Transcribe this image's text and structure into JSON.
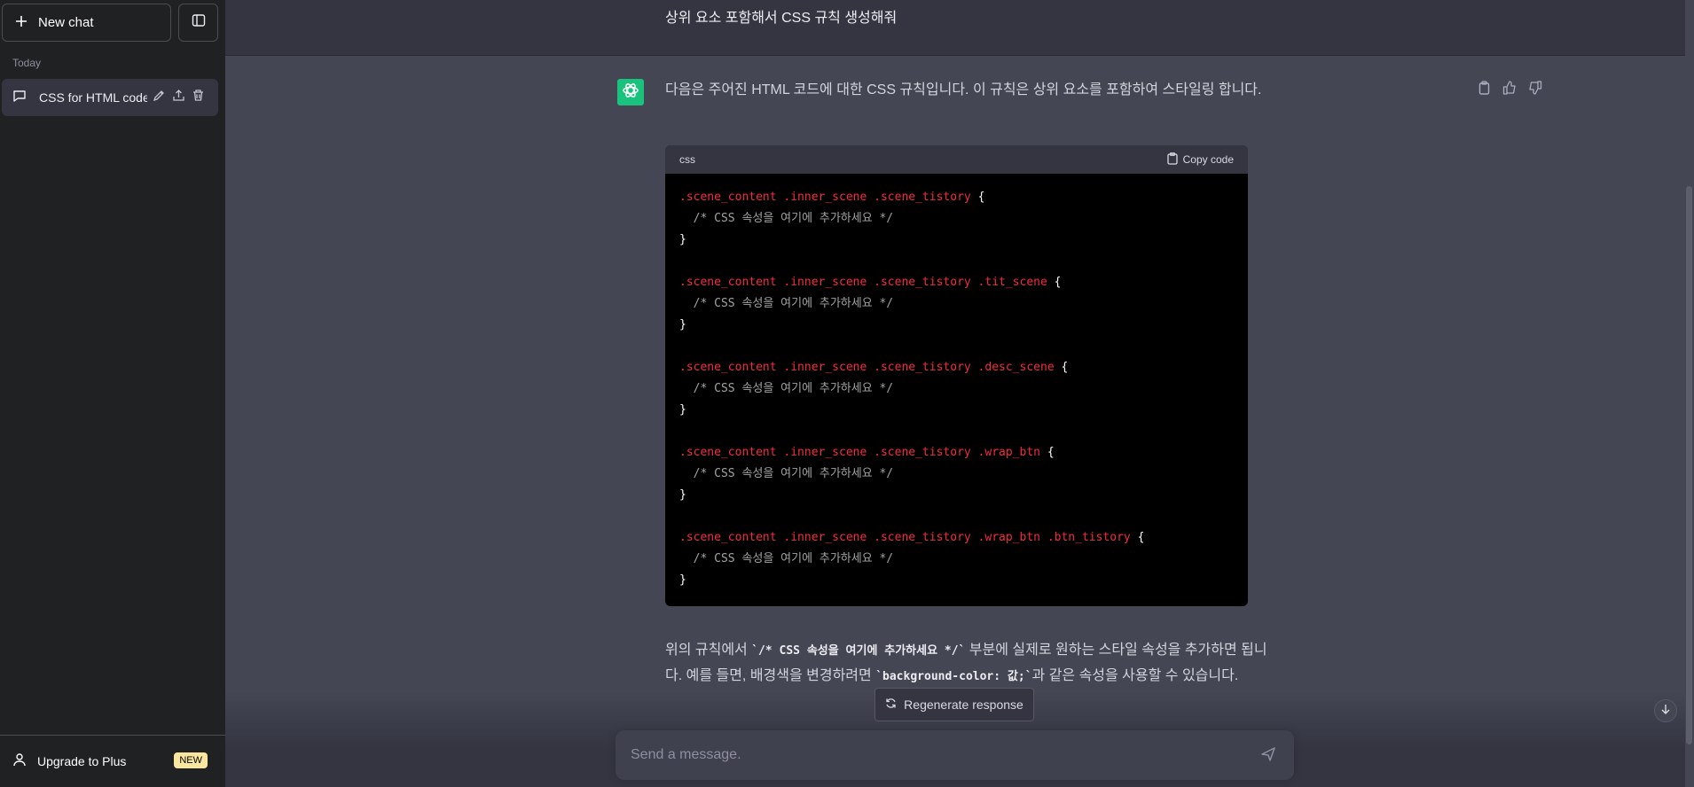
{
  "sidebar": {
    "new_chat_label": "New chat",
    "section_label": "Today",
    "chat_items": [
      {
        "label": "CSS for HTML code"
      }
    ],
    "upgrade_label": "Upgrade to Plus",
    "upgrade_badge": "NEW"
  },
  "conversation": {
    "user_message": "상위 요소 포함해서 CSS 규칙 생성해줘",
    "assistant_intro": "다음은 주어진 HTML 코드에 대한 CSS 규칙입니다. 이 규칙은 상위 요소를 포함하여 스타일링 합니다.",
    "code_language": "css",
    "copy_label": "Copy code",
    "code_blocks": [
      {
        "selector": ".scene_content .inner_scene .scene_tistory",
        "comment": "/* CSS 속성을 여기에 추가하세요 */"
      },
      {
        "selector": ".scene_content .inner_scene .scene_tistory .tit_scene",
        "comment": "/* CSS 속성을 여기에 추가하세요 */"
      },
      {
        "selector": ".scene_content .inner_scene .scene_tistory .desc_scene",
        "comment": "/* CSS 속성을 여기에 추가하세요 */"
      },
      {
        "selector": ".scene_content .inner_scene .scene_tistory .wrap_btn",
        "comment": "/* CSS 속성을 여기에 추가하세요 */"
      },
      {
        "selector": ".scene_content .inner_scene .scene_tistory .wrap_btn .btn_tistory",
        "comment": "/* CSS 속성을 여기에 추가하세요 */"
      }
    ],
    "brace_open": "{",
    "brace_close": "}",
    "explain_part1": "위의 규칙에서 ",
    "explain_code1": "`/* CSS 속성을 여기에 추가하세요 */`",
    "explain_part2": " 부분에 실제로 원하는 스타일 속성을 추가하면 됩니다. 예를 들면, 배경색을 변경하려면 ",
    "explain_code2": "`background-color: 값;`",
    "explain_part3": "과 같은 속성을 사용할 수 있습니다."
  },
  "composer": {
    "regenerate_label": "Regenerate response",
    "placeholder": "Send a message."
  },
  "colors": {
    "sidebar_bg": "#202123",
    "main_bg": "#444654",
    "user_bg": "#343541",
    "accent": "#19c37d",
    "selector": "#f22c3d"
  }
}
